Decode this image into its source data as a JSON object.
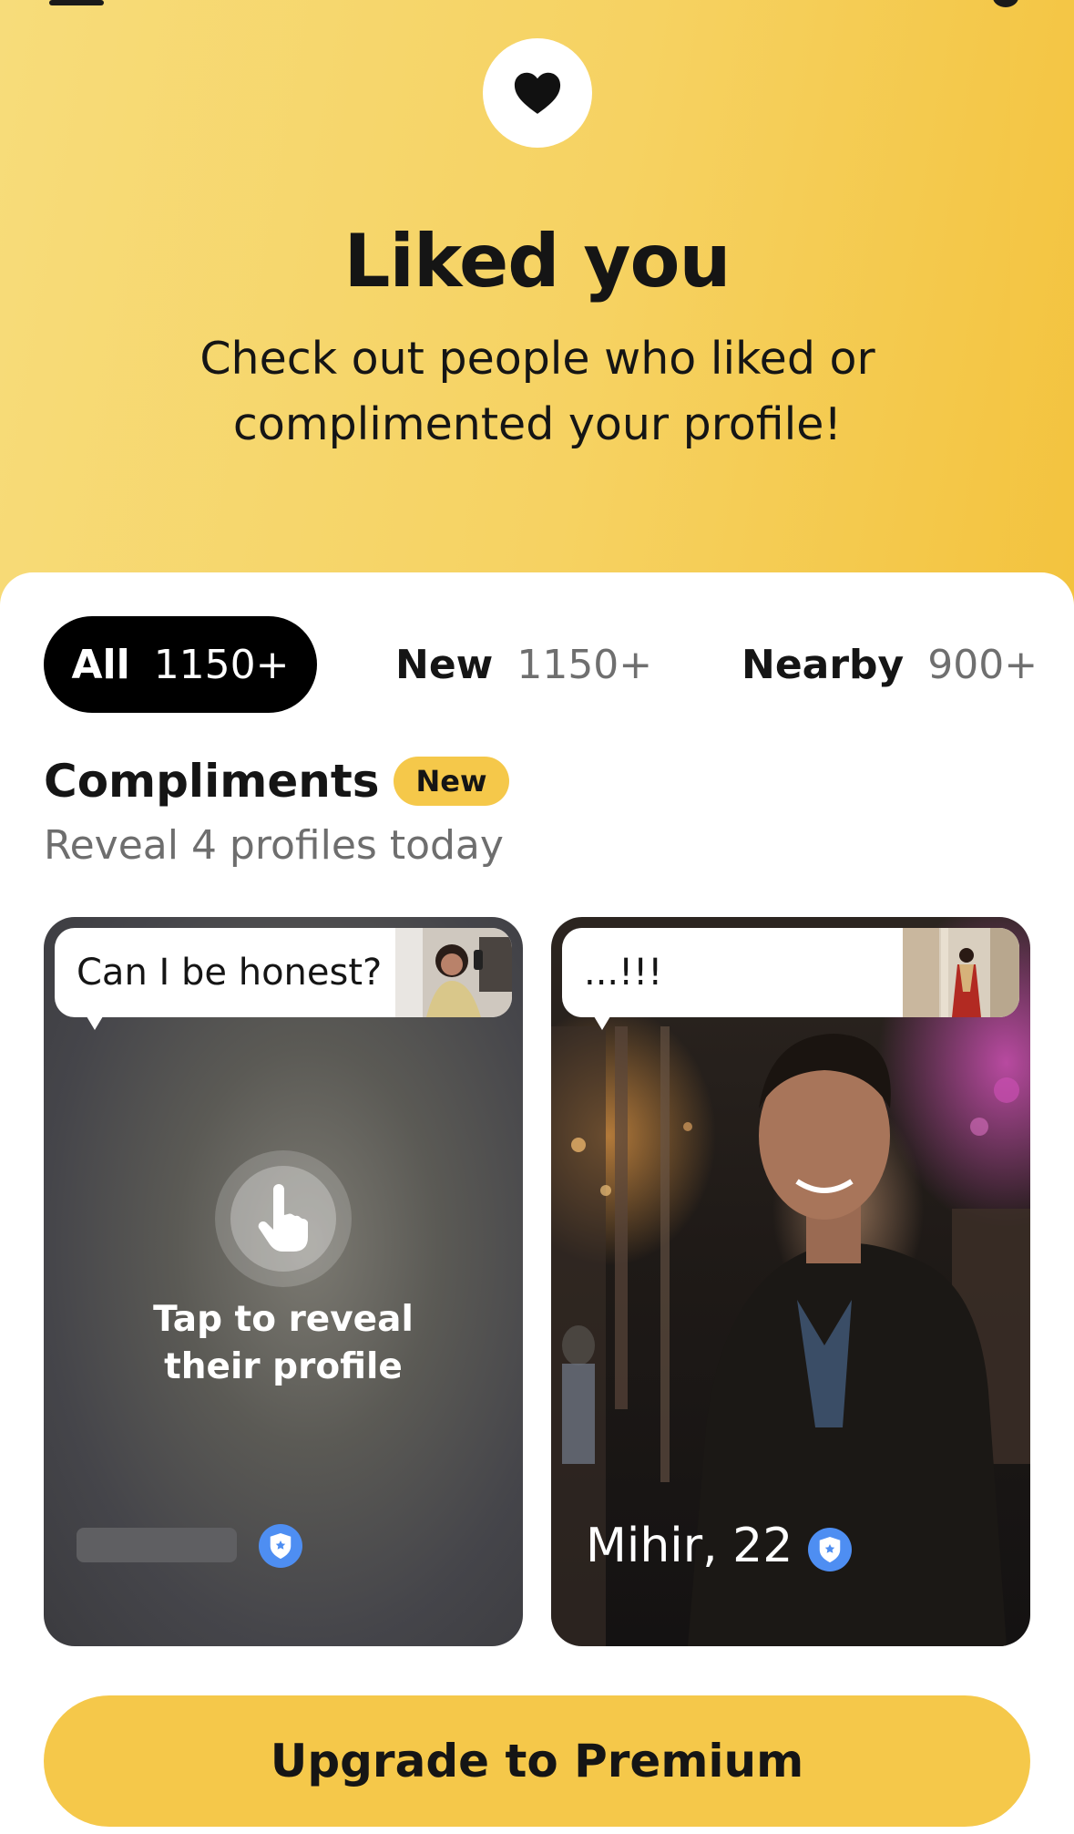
{
  "header": {
    "title": "Liked you",
    "subtitle_line1": "Check out people who liked or",
    "subtitle_line2": "complimented your profile!",
    "icon": "heart-icon"
  },
  "tabs": [
    {
      "label": "All",
      "count": "1150+",
      "selected": true
    },
    {
      "label": "New",
      "count": "1150+",
      "selected": false
    },
    {
      "label": "Nearby",
      "count": "900+",
      "selected": false
    }
  ],
  "compliments": {
    "title": "Compliments",
    "badge": "New",
    "subtitle": "Reveal 4 profiles today"
  },
  "cards": [
    {
      "message": "Can I be honest?",
      "reveal_line1": "Tap to reveal",
      "reveal_line2": "their profile",
      "name": "",
      "verified": true
    },
    {
      "message": "...!!!",
      "name": "Mihir, 22",
      "verified": true
    }
  ],
  "cta": {
    "label": "Upgrade to Premium"
  },
  "colors": {
    "accent": "#f5c84a",
    "header_bg": "#f6d262",
    "verify_blue": "#4e8ef2",
    "text": "#151515",
    "muted": "#6e6e6e"
  }
}
